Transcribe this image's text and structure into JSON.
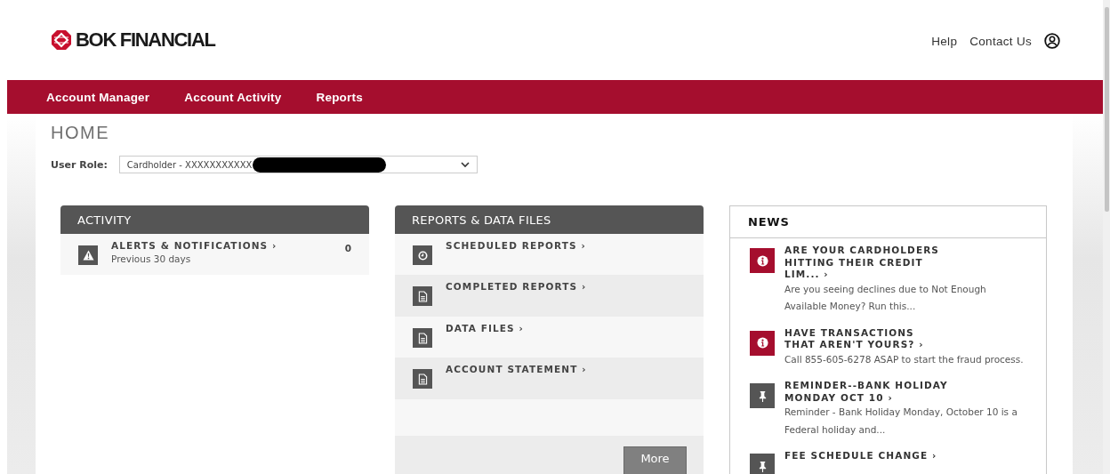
{
  "header": {
    "logo": "BOK FINANCIAL",
    "links": [
      "Help",
      "Contact Us"
    ]
  },
  "nav": [
    "Account Manager",
    "Account Activity",
    "Reports"
  ],
  "page_title": "HOME",
  "user_role": {
    "label": "User Role:",
    "value": "Cardholder - XXXXXXXXXXX"
  },
  "activity": {
    "title": "ACTIVITY",
    "items": [
      {
        "title": "ALERTS & NOTIFICATIONS ›",
        "subtitle": "Previous 30 days",
        "count": "0"
      }
    ]
  },
  "reports": {
    "title": "REPORTS & DATA FILES",
    "items": [
      {
        "title": "SCHEDULED REPORTS ›",
        "kind": "clock"
      },
      {
        "title": "COMPLETED REPORTS ›",
        "kind": "document"
      },
      {
        "title": "DATA FILES ›",
        "kind": "document"
      },
      {
        "title": "ACCOUNT STATEMENT ›",
        "kind": "document"
      }
    ],
    "button": "More"
  },
  "news": {
    "title": "NEWS",
    "items": [
      {
        "kind": "info",
        "title": "ARE YOUR CARDHOLDERS HITTING THEIR CREDIT LIM... ›",
        "body": "Are you seeing declines due to Not Enough Available Money? Run this..."
      },
      {
        "kind": "info",
        "title": "HAVE TRANSACTIONS THAT AREN'T YOURS? ›",
        "body": "Call 855-605-6278 ASAP to start the fraud process."
      },
      {
        "kind": "pin",
        "title": "REMINDER--BANK HOLIDAY MONDAY OCT 10 ›",
        "body": "Reminder - Bank Holiday Monday, October 10 is a Federal holiday and..."
      },
      {
        "kind": "pin",
        "title": "FEE SCHEDULE CHANGE ›"
      }
    ]
  }
}
